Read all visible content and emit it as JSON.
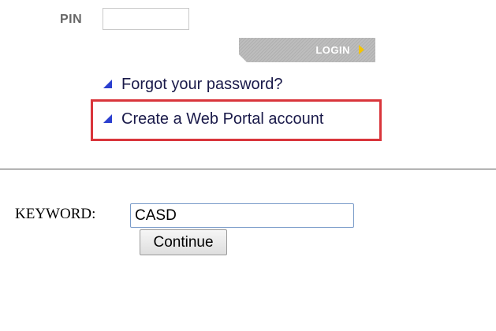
{
  "login_form": {
    "pin_label": "PIN",
    "pin_value": "",
    "login_label": "LOGIN"
  },
  "links": {
    "forgot_password": "Forgot your password?",
    "create_account": "Create a Web Portal account"
  },
  "icons": {
    "login_arrow": "yellow-play-arrow-icon",
    "link_bullet": "blue-triangle-icon"
  },
  "colors": {
    "highlight_border": "#d9353b",
    "link_bullet": "#2b3fcf",
    "login_arrow": "#f5c400"
  },
  "keyword_form": {
    "label": "KEYWORD:",
    "value": "CASD",
    "continue_label": "Continue"
  }
}
